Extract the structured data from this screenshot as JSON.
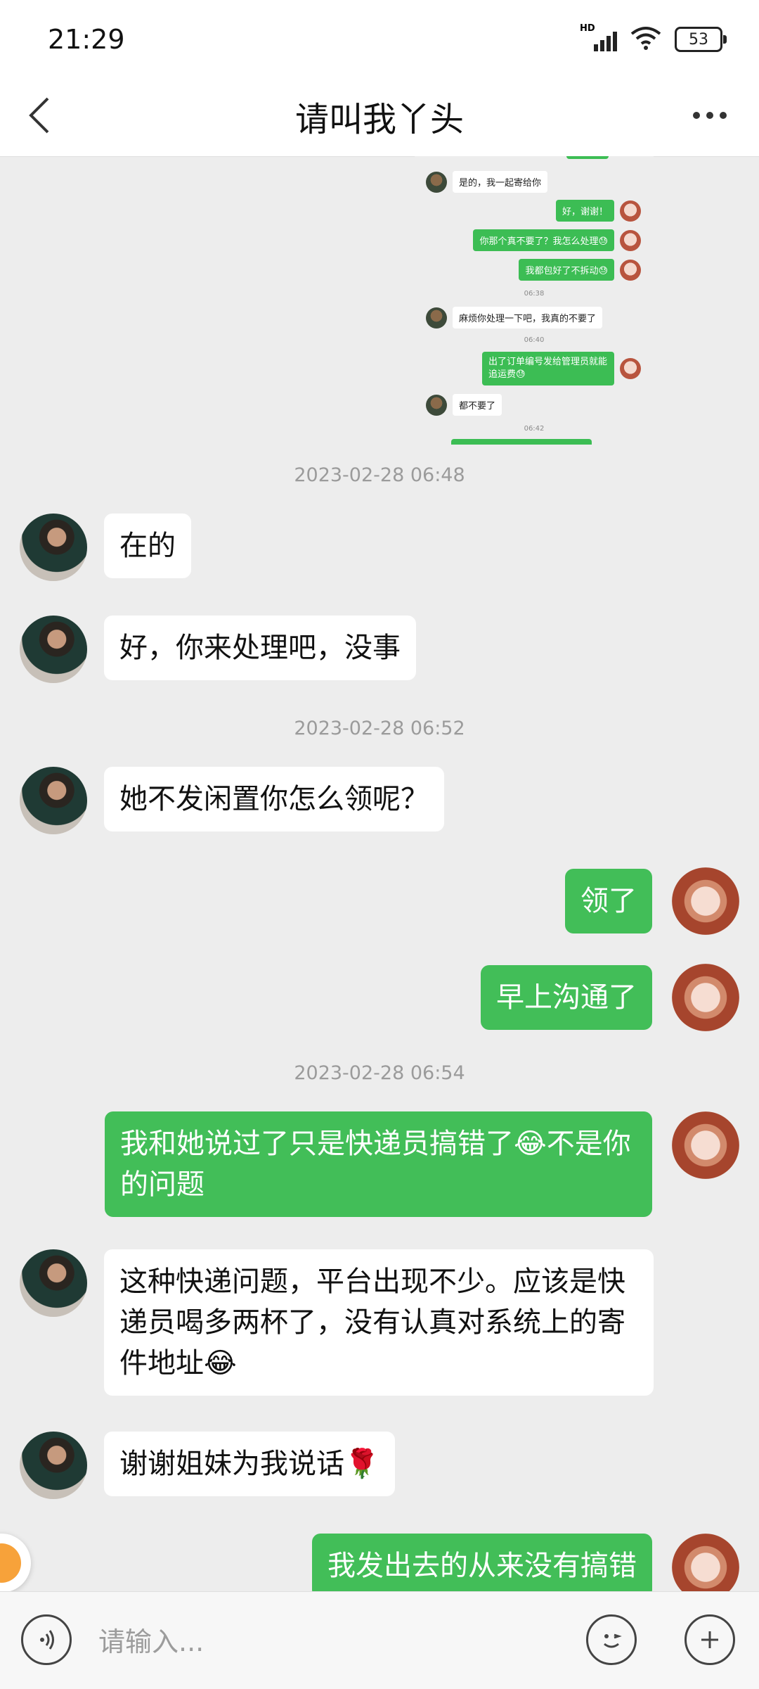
{
  "status": {
    "time": "21:29",
    "battery": "53",
    "network": "HD"
  },
  "header": {
    "title": "请叫我丫头"
  },
  "preview": {
    "messages": [
      {
        "side": "left",
        "text": "是的，我一起寄给你"
      },
      {
        "side": "right",
        "text": "好，谢谢！"
      },
      {
        "side": "right",
        "text": "你那个真不要了？我怎么处理😓"
      },
      {
        "side": "right",
        "text": "我都包好了不拆动😓"
      },
      {
        "side": "left",
        "text": "麻烦你处理一下吧，我真的不要了"
      },
      {
        "side": "right",
        "text": "出了订单编号发给管理员就能追运费😓"
      },
      {
        "side": "left",
        "text": "都不要了"
      }
    ],
    "times": [
      "06:38",
      "06:40",
      "06:42"
    ]
  },
  "chat": {
    "timestamps": [
      "2023-02-28 06:48",
      "2023-02-28 06:52",
      "2023-02-28 06:54"
    ],
    "messages": [
      {
        "side": "left",
        "text": "在的"
      },
      {
        "side": "left",
        "text": "好，你来处理吧，没事"
      },
      {
        "side": "left",
        "text": "她不发闲置你怎么领呢？"
      },
      {
        "side": "right",
        "text": "领了"
      },
      {
        "side": "right",
        "text": "早上沟通了"
      },
      {
        "side": "right",
        "text": "我和她说过了只是快递员搞错了😂不是你的问题"
      },
      {
        "side": "left",
        "text": "这种快递问题，平台出现不少。应该是快递员喝多两杯了，没有认真对系统上的寄件地址😂"
      },
      {
        "side": "left",
        "text": "谢谢姐妹为我说话🌹"
      },
      {
        "side": "right",
        "text": "我发出去的从来没有搞错"
      }
    ]
  },
  "input": {
    "placeholder": "请输入..."
  }
}
